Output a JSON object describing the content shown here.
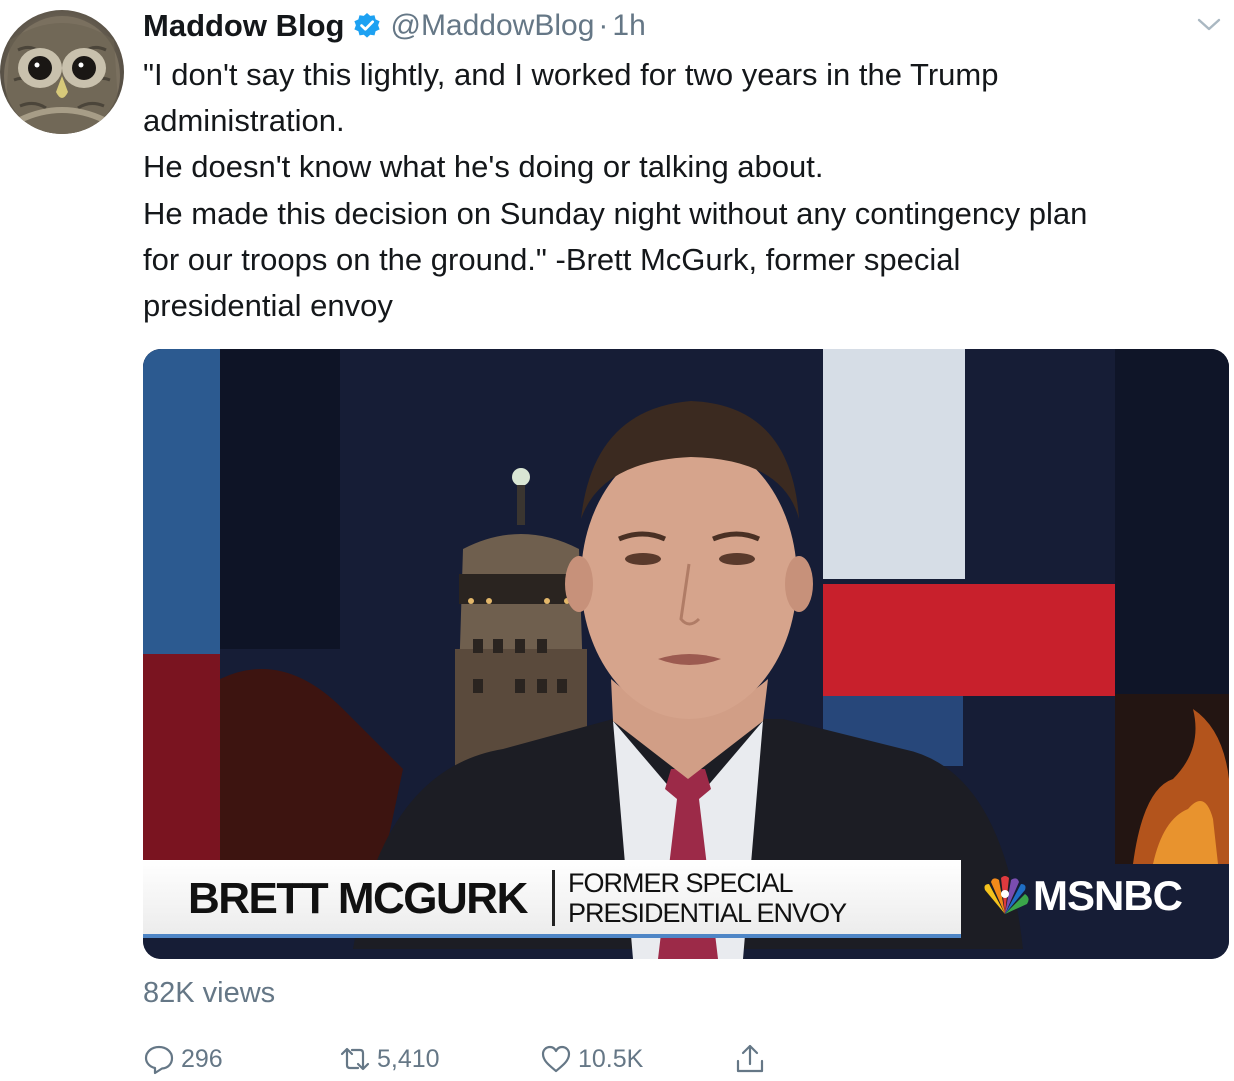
{
  "tweet": {
    "author_name": "Maddow Blog",
    "handle": "@MaddowBlog",
    "separator": "·",
    "time": "1h",
    "text_lines": [
      "\"I don't say this lightly, and I worked for two years in the Trump",
      "administration.",
      "He doesn't know what he's doing or talking about.",
      "He made this decision on Sunday night without any contingency plan",
      "for our troops on the ground.\" -Brett McGurk, former special",
      "presidential envoy"
    ],
    "video": {
      "lower_third_name": "BRETT MCGURK",
      "lower_third_title_line1": "FORMER SPECIAL",
      "lower_third_title_line2": "PRESIDENTIAL ENVOY",
      "network": "MSNBC"
    },
    "views": "82K views",
    "actions": {
      "reply_count": "296",
      "retweet_count": "5,410",
      "like_count": "10.5K"
    }
  },
  "colors": {
    "text": "#14171a",
    "secondary_text": "#657786",
    "verified_badge": "#1da1f2",
    "lower_third_accent": "#4f86c6"
  },
  "icons": {
    "avatar": "owl-avatar",
    "verified": "verified-badge-icon",
    "menu": "chevron-down-icon",
    "reply": "reply-icon",
    "retweet": "retweet-icon",
    "like": "heart-icon",
    "share": "share-icon"
  }
}
